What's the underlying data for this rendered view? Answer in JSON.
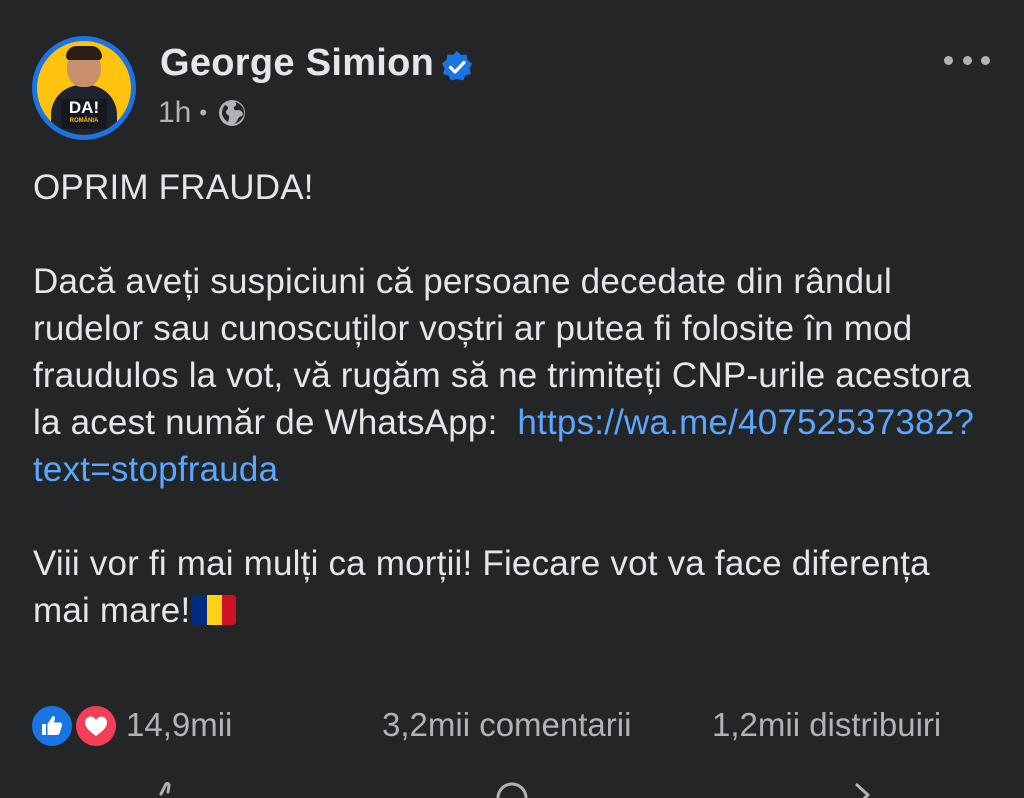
{
  "post": {
    "author": "George Simion",
    "timestamp": "1h",
    "audience_icon": "globe-icon",
    "avatar_logo": "DA!",
    "avatar_logo_sub": "ROMÂNIA",
    "body": {
      "title": "OPRIM FRAUDA!",
      "paragraph1": "Dacă aveți suspiciuni că persoane decedate din rândul rudelor sau cunoscuților voștri ar putea fi folosite în mod fraudulos la vot, vă rugăm să ne trimiteți CNP-urile acestora la acest număr de WhatsApp:",
      "link": "https://wa.me/40752537382?text=stopfrauda",
      "paragraph2": "Viii vor fi mai mulți ca morții! Fiecare vot va face diferența mai mare!"
    },
    "reactions": {
      "count": "14,9mii",
      "types": [
        "like-icon",
        "love-icon"
      ]
    },
    "comments": "3,2mii comentarii",
    "shares": "1,2mii distribuiri"
  },
  "colors": {
    "background": "#242526",
    "text": "#e4e6eb",
    "secondary": "#b0b3b8",
    "link": "#5aa7ff",
    "verified": "#1b74e4",
    "like": "#1b74e4",
    "love": "#f33e58",
    "flag": [
      "#002b7f",
      "#fcd116",
      "#ce1126"
    ]
  }
}
